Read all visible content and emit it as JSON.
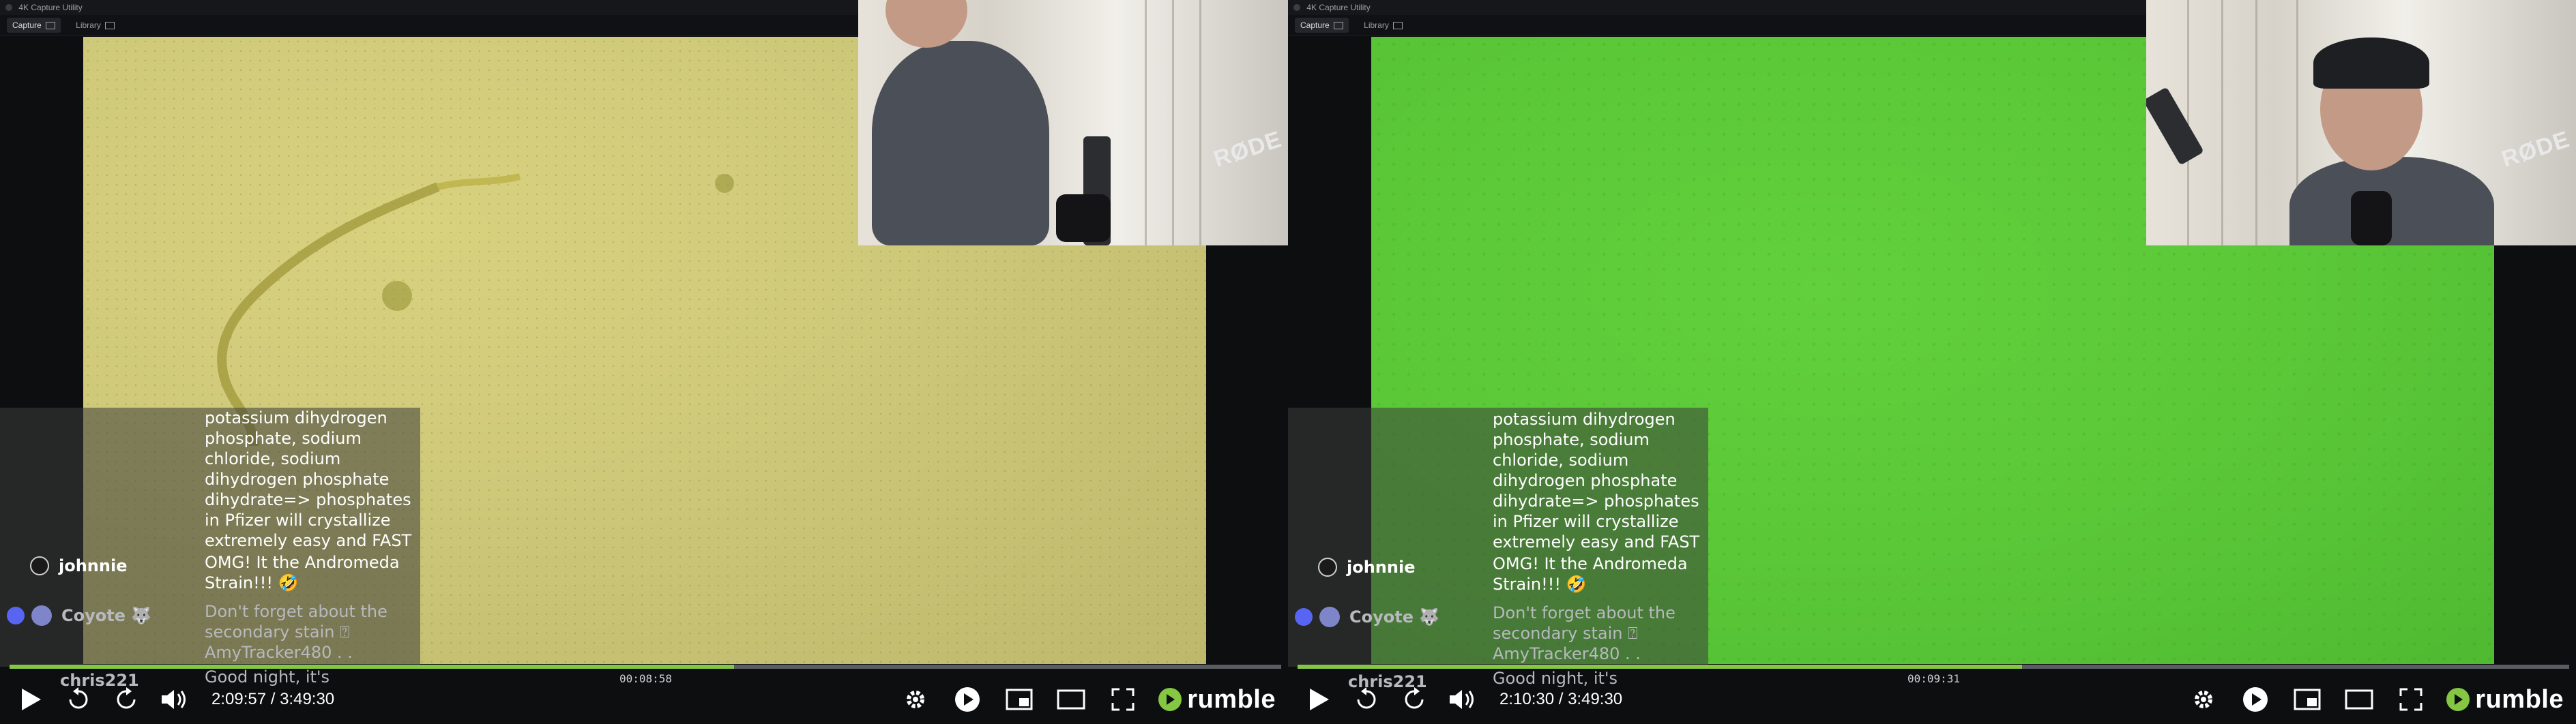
{
  "panels": [
    {
      "id": "left",
      "app": {
        "title": "4K Capture Utility",
        "tabs": [
          "Capture",
          "Library"
        ]
      },
      "scope_color": "#d2cc7c",
      "chat": {
        "message_main": [
          "potassium dihydrogen",
          "phosphate, sodium",
          "chloride, sodium",
          "dihydrogen phosphate",
          "dihydrate=> phosphates",
          "in Pfizer will crystallize",
          "extremely easy and FAST"
        ],
        "user1": "johnnie",
        "user1_msg": [
          "OMG! It the Andromeda",
          "Strain!!! 🤣"
        ],
        "user2": "Coyote 🐺",
        "user2_msg": [
          "Don't forget about the",
          "secondary stain ⍰",
          "AmyTracker480 . ."
        ],
        "user3": "chris221",
        "user3_msg": "Good night, it's"
      },
      "inner_time": "00:08:58",
      "progress": 0.57,
      "time": "2:09:57 / 3:49:30",
      "brand": "rumble"
    },
    {
      "id": "right",
      "app": {
        "title": "4K Capture Utility",
        "tabs": [
          "Capture",
          "Library"
        ]
      },
      "scope_color": "#5ec83a",
      "chat": {
        "message_main": [
          "potassium dihydrogen",
          "phosphate, sodium",
          "chloride, sodium",
          "dihydrogen phosphate",
          "dihydrate=> phosphates",
          "in Pfizer will crystallize",
          "extremely easy and FAST"
        ],
        "user1": "johnnie",
        "user1_msg": [
          "OMG! It the Andromeda",
          "Strain!!! 🤣"
        ],
        "user2": "Coyote 🐺",
        "user2_msg": [
          "Don't forget about the",
          "secondary stain ⍰",
          "AmyTracker480 . ."
        ],
        "user3": "chris221",
        "user3_msg": "Good night, it's"
      },
      "inner_time": "00:09:31",
      "progress": 0.57,
      "time": "2:10:30 / 3:49:30",
      "brand": "rumble"
    }
  ],
  "webcam": {
    "brand_text": "RØDE"
  },
  "colors": {
    "accent": "#85c742",
    "background": "#0d0e10"
  },
  "icons": [
    "play-icon",
    "rewind-icon",
    "forward-icon",
    "volume-icon",
    "settings-icon",
    "play-circle-icon",
    "picture-in-picture-icon",
    "theater-icon",
    "fullscreen-icon"
  ]
}
